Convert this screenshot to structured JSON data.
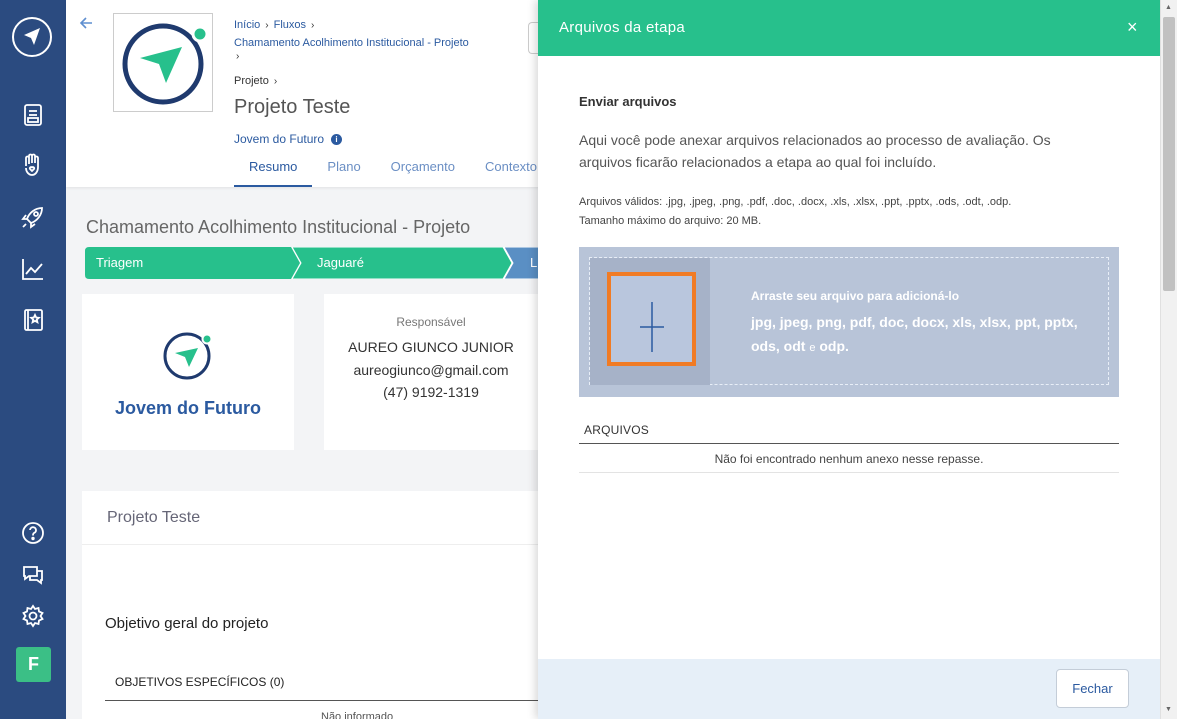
{
  "breadcrumb": {
    "home": "Início",
    "fluxos": "Fluxos",
    "chamamento": "Chamamento Acolhimento Institucional - Projeto",
    "projeto": "Projeto"
  },
  "header": {
    "title": "Projeto Teste",
    "organization": "Jovem do Futuro",
    "info_glyph": "i",
    "tabs": [
      "Resumo",
      "Plano",
      "Orçamento",
      "Contexto"
    ]
  },
  "content": {
    "title": "Chamamento Acolhimento Institucional - Projeto",
    "steps": [
      "Triagem",
      "Jaguaré",
      "Li"
    ],
    "org_name": "Jovem do Futuro",
    "responsavel_label": "Responsável",
    "responsavel_name": "AUREO GIUNCO JUNIOR",
    "responsavel_email": "aureogiunco@gmail.com",
    "responsavel_phone": "(47) 9192-1319",
    "card_title": "Projeto Teste",
    "objetivo_geral": "Objetivo geral do projeto",
    "objetivos_especificos": "OBJETIVOS ESPECÍFICOS (0)",
    "nao_informado": "Não informado"
  },
  "sidebar": {
    "avatar_initial": "F",
    "icons": [
      "logo-icon",
      "document-icon",
      "hand-heart-icon",
      "rocket-icon",
      "chart-icon",
      "book-star-icon",
      "help-icon",
      "chat-icon",
      "gear-icon"
    ]
  },
  "panel": {
    "title": "Arquivos da etapa",
    "close_glyph": "×",
    "heading": "Enviar arquivos",
    "description": "Aqui você pode anexar arquivos relacionados ao processo de avaliação. Os arquivos ficarão relacionados a etapa ao qual foi incluído.",
    "valid_files": "Arquivos válidos: .jpg, .jpeg, .png, .pdf, .doc, .docx, .xls, .xlsx, .ppt, .pptx, .ods, .odt, .odp.",
    "max_size": "Tamanho máximo do arquivo: 20 MB.",
    "drop_hint": "Arraste seu arquivo para adicioná-lo",
    "drop_formats_1": "jpg, jpeg, png, pdf, doc, docx, xls, xlsx, ppt, pptx,",
    "drop_formats_2a": "ods, odt",
    "drop_formats_2b": "e",
    "drop_formats_2c": "odp.",
    "files_header": "ARQUIVOS",
    "files_empty": "Não foi encontrado nenhum anexo nesse repasse.",
    "close_button": "Fechar"
  },
  "colors": {
    "sidebar": "#2b4b80",
    "panel_header": "#27c08c",
    "step_active": "#27c08c",
    "step_next": "#5a8fc4",
    "brand_blue": "#2b5aa0",
    "upload_highlight": "#f17b24"
  }
}
